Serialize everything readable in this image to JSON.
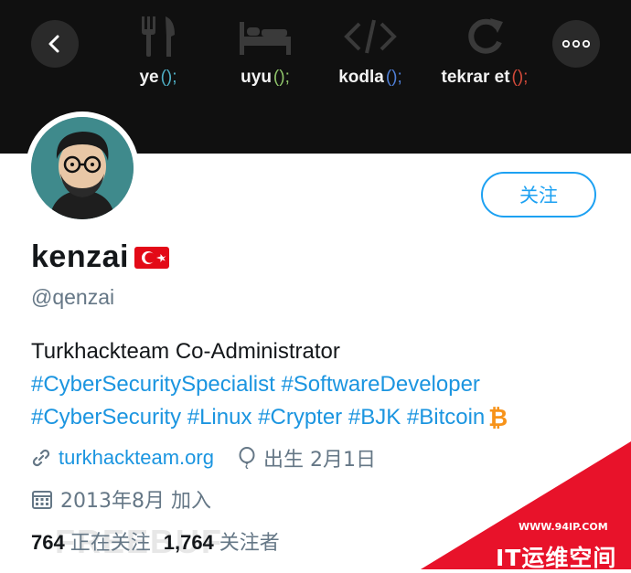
{
  "banner": {
    "items": [
      {
        "icon": "fork-knife-icon",
        "label": "ye",
        "paren": "();",
        "paren_color": "#4fb0c6"
      },
      {
        "icon": "bed-icon",
        "label": "uyu",
        "paren": "();",
        "paren_color": "#8fc46a"
      },
      {
        "icon": "code-icon",
        "label": "kodla",
        "paren": "();",
        "paren_color": "#4f7fd6"
      },
      {
        "icon": "refresh-icon",
        "label": "tekrar et",
        "paren": "();",
        "paren_color": "#d24a3a"
      }
    ]
  },
  "nav": {
    "back_icon": "back-arrow-icon",
    "more_icon": "more-dots-icon"
  },
  "profile": {
    "follow_label": "关注",
    "display_name": "kenzai",
    "handle": "@qenzai",
    "bio_line1": "Turkhackteam Co-Administrator",
    "hashtags_line2": [
      "#CyberSecuritySpecialist",
      "#SoftwareDeveloper"
    ],
    "hashtags_line3": [
      "#CyberSecurity",
      "#Linux",
      "#Crypter",
      "#BJK",
      "#Bitcoin"
    ],
    "website": "turkhackteam.org",
    "birthday": "出生 2月1日",
    "joined": "2013年8月 加入",
    "following_count": "764",
    "following_label": "正在关注",
    "followers_count": "1,764",
    "followers_label": "关注者"
  },
  "watermark": {
    "text": "FREEBUF",
    "corner_url": "WWW.94IP.COM",
    "corner_title": "IT运维空间"
  },
  "colors": {
    "accent": "#1da1f2",
    "link": "#1b95e0",
    "muted": "#657786",
    "corner_red": "#e8122a",
    "bitcoin": "#f7931a"
  }
}
